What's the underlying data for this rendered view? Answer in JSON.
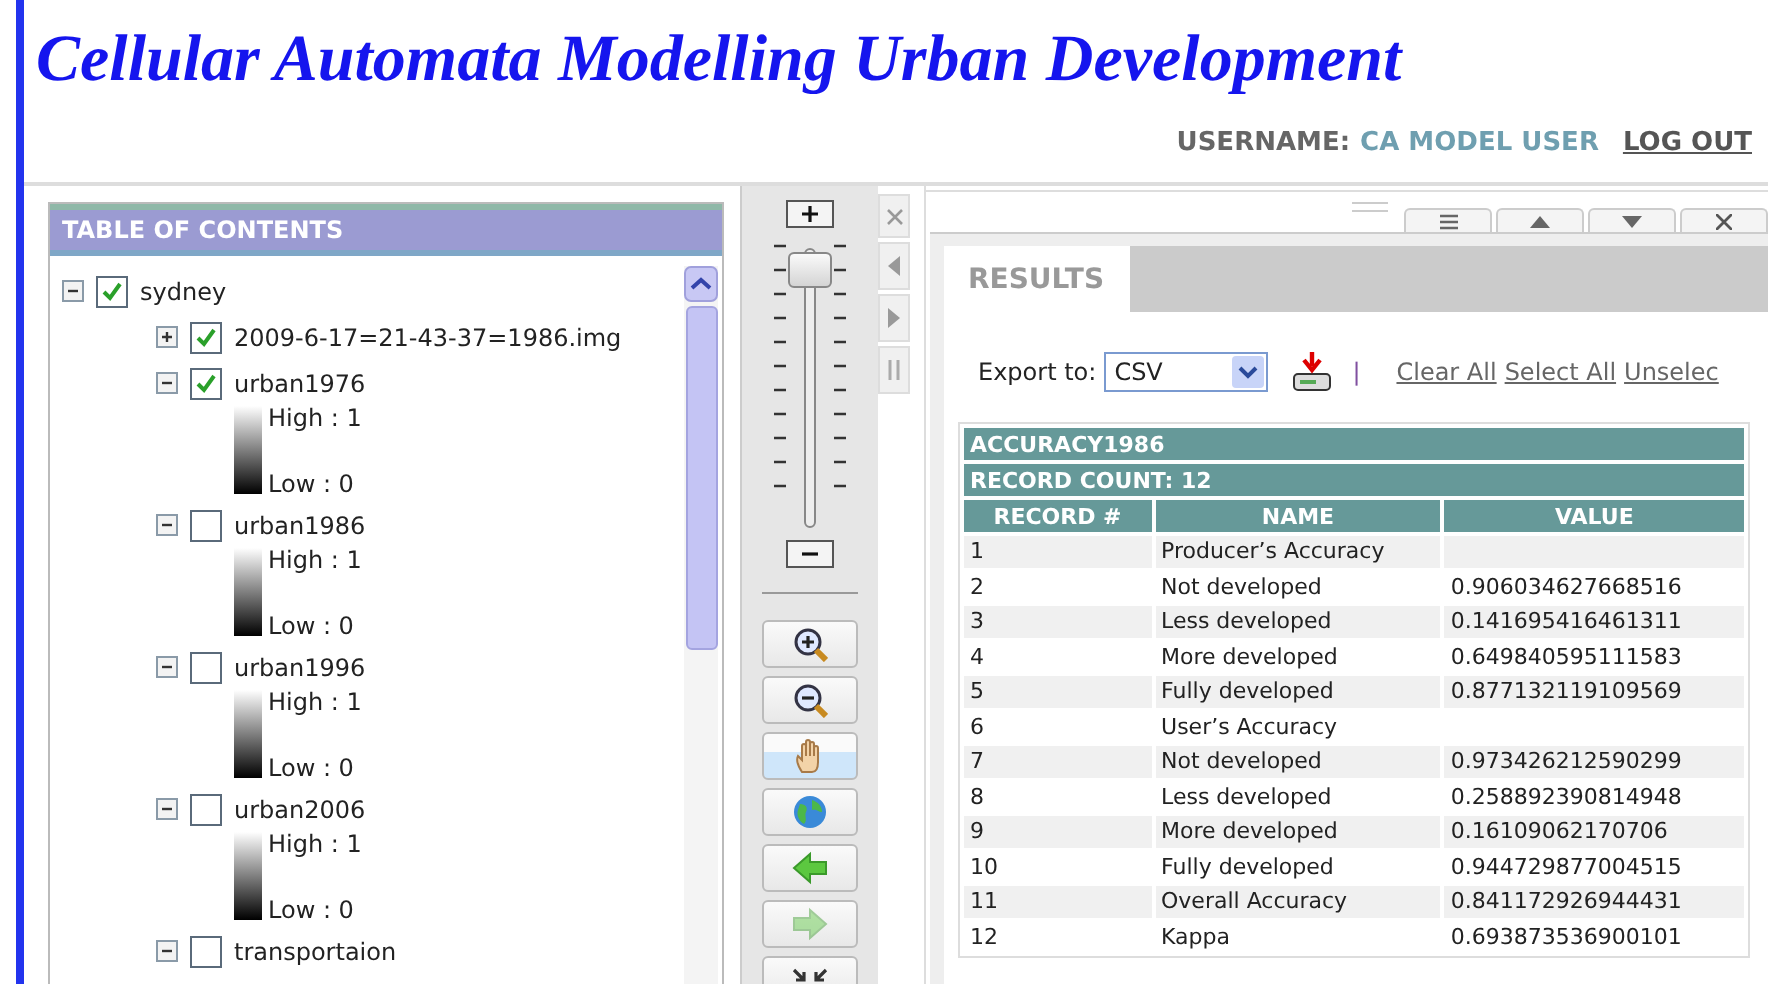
{
  "title": "Cellular Automata Modelling Urban Development",
  "user": {
    "label": "USERNAME:",
    "name": "CA MODEL USER",
    "logout": "LOG OUT"
  },
  "toc": {
    "title": "TABLE OF CONTENTS",
    "layers": [
      {
        "name": "sydney",
        "checked": true,
        "expanded": true,
        "children": [
          {
            "name": "2009-6-17=21-43-37=1986.img",
            "checked": true,
            "expanded": false
          },
          {
            "name": "urban1976",
            "checked": true,
            "expanded": true,
            "legend": {
              "high": "High : 1",
              "low": "Low : 0"
            }
          },
          {
            "name": "urban1986",
            "checked": false,
            "expanded": true,
            "legend": {
              "high": "High : 1",
              "low": "Low : 0"
            }
          },
          {
            "name": "urban1996",
            "checked": false,
            "expanded": true,
            "legend": {
              "high": "High : 1",
              "low": "Low : 0"
            }
          },
          {
            "name": "urban2006",
            "checked": false,
            "expanded": true,
            "legend": {
              "high": "High : 1",
              "low": "Low : 0"
            }
          },
          {
            "name": "transportaion",
            "checked": false,
            "expanded": true
          }
        ]
      }
    ]
  },
  "map_tools": {
    "zoom_slider": {
      "level": 0.95
    },
    "tools": [
      {
        "kind": "zoom-in",
        "selected": false,
        "disabled": false
      },
      {
        "kind": "zoom-out",
        "selected": false,
        "disabled": false
      },
      {
        "kind": "pan",
        "selected": true,
        "disabled": false
      },
      {
        "kind": "full-extent",
        "selected": false,
        "disabled": false
      },
      {
        "kind": "back",
        "selected": false,
        "disabled": false
      },
      {
        "kind": "forward",
        "selected": false,
        "disabled": true
      },
      {
        "kind": "shrink",
        "selected": false,
        "disabled": false
      }
    ]
  },
  "results": {
    "tab": "RESULTS",
    "export_label": "Export to:",
    "export_format": "CSV",
    "separator": "|",
    "links": [
      "Clear All",
      "Select All",
      "Unselec"
    ],
    "table": {
      "title": "ACCURACY1986",
      "record_count": "RECORD COUNT: 12",
      "columns": [
        "RECORD #",
        "NAME",
        "VALUE"
      ],
      "rows": [
        {
          "record": "1",
          "name": "Producer’s Accuracy"
        },
        {
          "record": "2",
          "name": "Not developed",
          "value": "0.906034627668516"
        },
        {
          "record": "3",
          "name": "Less developed",
          "value": "0.141695416461311"
        },
        {
          "record": "4",
          "name": "More developed",
          "value": "0.649840595111583"
        },
        {
          "record": "5",
          "name": "Fully developed",
          "value": "0.877132119109569"
        },
        {
          "record": "6",
          "name": "User’s Accuracy"
        },
        {
          "record": "7",
          "name": "Not developed",
          "value": "0.973426212590299"
        },
        {
          "record": "8",
          "name": "Less developed",
          "value": "0.258892390814948"
        },
        {
          "record": "9",
          "name": "More developed",
          "value": "0.16109062170706"
        },
        {
          "record": "10",
          "name": "Fully developed",
          "value": "0.944729877004515"
        },
        {
          "record": "11",
          "name": "Overall Accuracy",
          "value": "0.841172926944431"
        },
        {
          "record": "12",
          "name": "Kappa",
          "value": "0.693873536900101"
        }
      ]
    }
  }
}
